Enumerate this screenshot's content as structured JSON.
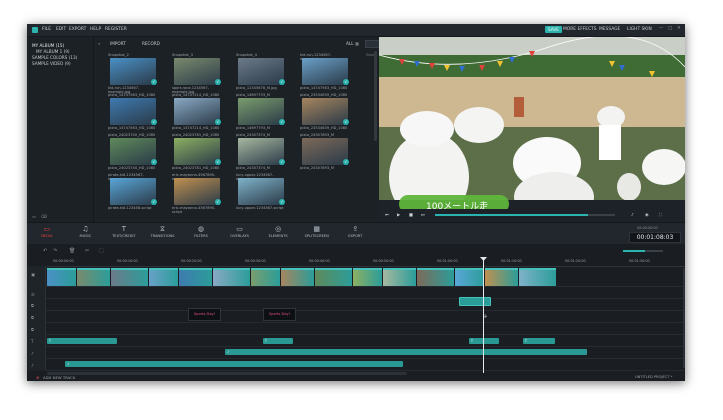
{
  "menubar": {
    "items": [
      "FILE",
      "EDIT",
      "EXPORT",
      "HELP",
      "REGISTER"
    ],
    "right": [
      "SAVE",
      "MORE EFFECTS",
      "MESSAGE",
      "LIGHT SKIN"
    ]
  },
  "library": {
    "items": [
      "MY ALBUM (15)",
      "MY ALBUM 1 (9)",
      "SAMPLE COLORS (13)",
      "SAMPLE VIDEO (9)"
    ]
  },
  "media_toolbar": {
    "import": "IMPORT",
    "record": "RECORD",
    "all": "ALL",
    "search_placeholder": "Search"
  },
  "media_items": [
    {
      "label": "Snapshot_2",
      "sub": "kid-run-1234567-example.jpg",
      "color": "#4a90c6"
    },
    {
      "label": "Snapshot_3",
      "sub": "sport-race-1234567-example.jpg",
      "color": "#7a8a6d"
    },
    {
      "label": "Snapshot_4",
      "sub": "pixta_12345678_M.jpg",
      "color": "#6c7a8a"
    },
    {
      "label": "kid-run-1234567-example.jpg",
      "sub": "pixta_14747563_HD_1080",
      "color": "#6aa0c8"
    },
    {
      "label": "pixta_14747563_HD_1080",
      "sub": "pixta_14747563_HD_1080",
      "color": "#3e7ab0"
    },
    {
      "label": "pixta_14747214_HD_1080",
      "sub": "pixta_14747214_HD_1080",
      "color": "#8aa9c4"
    },
    {
      "label": "pixta_14697793_M",
      "sub": "pixta_14697793_M",
      "color": "#7b9d6d"
    },
    {
      "label": "pixta_23534639_HD_1080",
      "sub": "pixta_23534639_HD_1080",
      "color": "#a7855e"
    },
    {
      "label": "pixta_24023740_HD_1080",
      "sub": "pixta_24023740_HD_1080",
      "color": "#5f8a5a"
    },
    {
      "label": "pixta_24023781_HD_1080",
      "sub": "pixta_24023781_HD_1080",
      "color": "#8db062"
    },
    {
      "label": "pixta_24307374_M",
      "sub": "pixta_24307374_M",
      "color": "#a8b8a0"
    },
    {
      "label": "pixta_24307893_M",
      "sub": "pixta_24307893_M",
      "color": "#7d6a5a"
    },
    {
      "label": "pirate-kid-1234567-example.jpg",
      "sub": "pirate-kid-123456-script",
      "color": "#5aa6d8"
    },
    {
      "label": "eric-mayanna-4567890-example.jpg",
      "sub": "eric-mayanna-4567890-script",
      "color": "#c09050"
    },
    {
      "label": "lucy-upper-1234567-example.jpg",
      "sub": "lucy-upper-1234567-script",
      "color": "#7fb2c9"
    }
  ],
  "preview": {
    "caption": "100メートル走"
  },
  "toolbar": {
    "tools": [
      {
        "label": "MEDIA",
        "icon": "folder-icon"
      },
      {
        "label": "MUSIC",
        "icon": "music-icon"
      },
      {
        "label": "TEXT/CREDIT",
        "icon": "text-icon"
      },
      {
        "label": "TRANSITIONS",
        "icon": "transition-icon"
      },
      {
        "label": "FILTERS",
        "icon": "filter-icon"
      },
      {
        "label": "OVERLAYS",
        "icon": "overlay-icon"
      },
      {
        "label": "ELEMENTS",
        "icon": "element-icon"
      },
      {
        "label": "SPLITSCREEN",
        "icon": "splitscreen-icon"
      },
      {
        "label": "EXPORT",
        "icon": "export-icon"
      }
    ],
    "timecode_label": "00:00:00:00",
    "timecode": "00:01:08:03"
  },
  "timeline": {
    "ticks": [
      "00:00:00:00",
      "00:00:10:00",
      "00:00:20:00",
      "00:00:30:00",
      "00:00:40:00",
      "00:00:50:00",
      "00:01:00:00",
      "00:01:10:00",
      "00:01:20:00",
      "00:01:30:00"
    ],
    "add_new_track": "ADD NEW TRACK",
    "project_name": "UNTITLED PROJECT *",
    "title_clips": [
      "Sports Day!",
      "Sports Day!"
    ]
  },
  "colors": {
    "accent": "#2bb3ad",
    "bg": "#1d2228"
  }
}
